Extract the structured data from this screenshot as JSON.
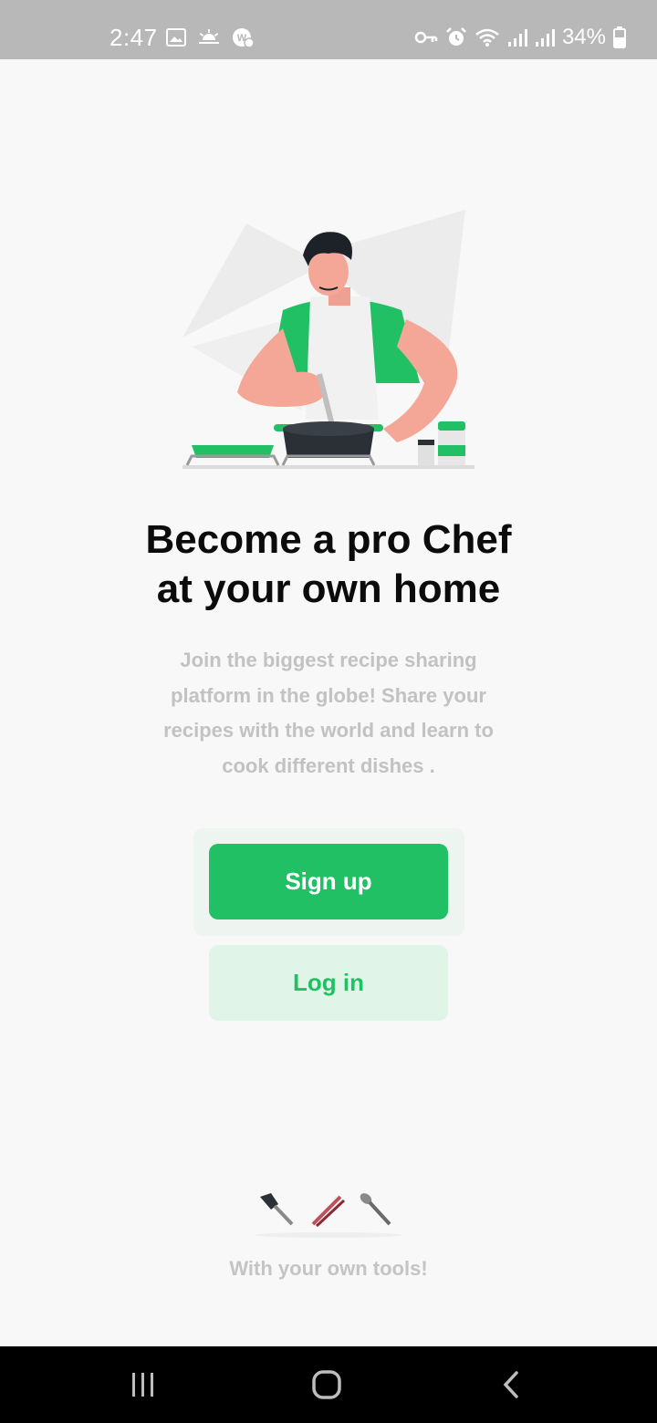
{
  "status_bar": {
    "time": "2:47",
    "battery": "34%",
    "left_icons": [
      "gallery-icon",
      "weather-sunrise-icon",
      "app-notification-icon"
    ],
    "right_icons": [
      "vpn-key-icon",
      "alarm-icon",
      "wifi-icon",
      "signal-icon",
      "signal-icon",
      "battery-icon"
    ]
  },
  "hero": {
    "illustration": "chef-cooking-illustration"
  },
  "onboarding": {
    "headline_line1": "Become a pro Chef",
    "headline_line2": "at your own home",
    "description": "Join the biggest recipe sharing platform in the globe! Share your recipes with the world and learn to cook different dishes ."
  },
  "actions": {
    "signup_label": "Sign up",
    "login_label": "Log in"
  },
  "footer": {
    "tools_icon": "kitchen-tools-icon",
    "caption": "With your own tools!"
  },
  "nav_bar": {
    "buttons": [
      "recent-apps-icon",
      "home-icon",
      "back-icon"
    ]
  },
  "colors": {
    "accent": "#22c064",
    "accent_light": "#e0f5e8",
    "status_bar": "#b8b8b8",
    "muted_text": "#c2c2c2"
  }
}
